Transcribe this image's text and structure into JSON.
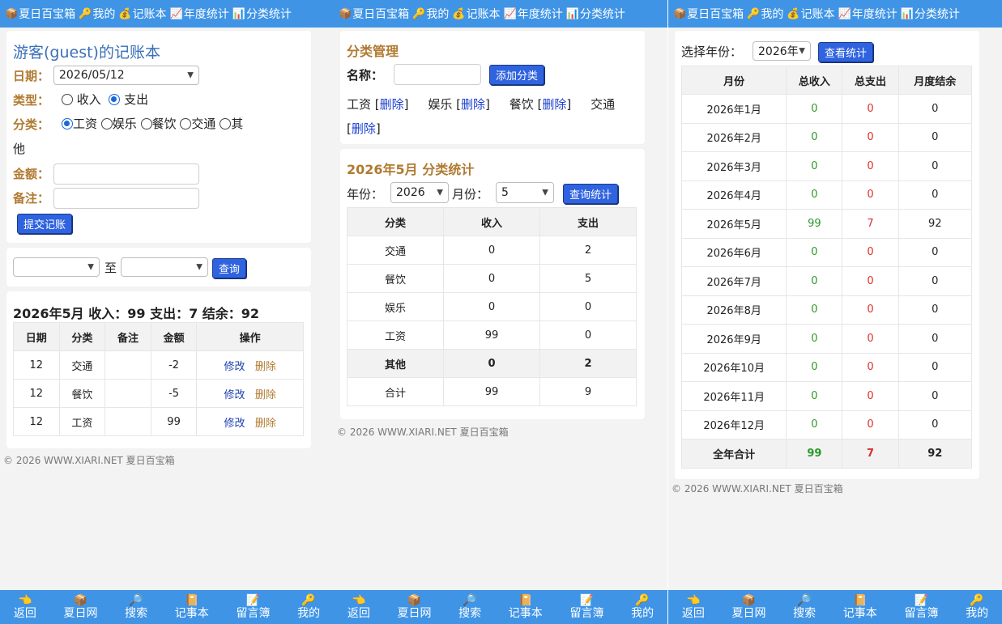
{
  "nav": [
    {
      "icon": "📦",
      "label": "夏日百宝箱"
    },
    {
      "icon": "🔑",
      "label": "我的"
    },
    {
      "icon": "💰",
      "label": "记账本"
    },
    {
      "icon": "📈",
      "label": "年度统计"
    },
    {
      "icon": "📊",
      "label": "分类统计"
    }
  ],
  "bottom": [
    {
      "icon": "👈",
      "label": "返回"
    },
    {
      "icon": "📦",
      "label": "夏日网"
    },
    {
      "icon": "🔎",
      "label": "搜索"
    },
    {
      "icon": "📔",
      "label": "记事本"
    },
    {
      "icon": "📝",
      "label": "留言簿"
    },
    {
      "icon": "🔑",
      "label": "我的"
    }
  ],
  "footer": "© 2026 WWW.XIARI.NET 夏日百宝箱",
  "ledger": {
    "title": "游客(guest)的记账本",
    "date_label": "日期：",
    "date_value": "2026/05/12",
    "type_label": "类型：",
    "type_income": "收入",
    "type_expense": "支出",
    "cat_label": "分类：",
    "cats": [
      "工资",
      "娱乐",
      "餐饮",
      "交通",
      "其"
    ],
    "cat_wrap": "他",
    "amount_label": "金额：",
    "note_label": "备注：",
    "submit": "提交记账",
    "range_to": "至",
    "query": "查询",
    "summary": "2026年5月 收入：99 支出：7 结余：92",
    "headers": [
      "日期",
      "分类",
      "备注",
      "金额",
      "操作"
    ],
    "rows": [
      {
        "day": "12",
        "cat": "交通",
        "note": "",
        "amt": "-2"
      },
      {
        "day": "12",
        "cat": "餐饮",
        "note": "",
        "amt": "-5"
      },
      {
        "day": "12",
        "cat": "工资",
        "note": "",
        "amt": "99"
      }
    ],
    "edit": "修改",
    "del": "删除"
  },
  "category": {
    "title": "分类管理",
    "name_label": "名称：",
    "add_btn": "添加分类",
    "items": [
      "工资",
      "娱乐",
      "餐饮",
      "交通"
    ],
    "del_word": "删除",
    "stats_title": "2026年5月 分类统计",
    "year_label": "年份：",
    "year_value": "2026",
    "month_label": "月份：",
    "month_value": "5",
    "query_btn": "查询统计",
    "headers": [
      "分类",
      "收入",
      "支出"
    ],
    "rows": [
      {
        "c": "交通",
        "i": "0",
        "e": "2"
      },
      {
        "c": "餐饮",
        "i": "0",
        "e": "5"
      },
      {
        "c": "娱乐",
        "i": "0",
        "e": "0"
      },
      {
        "c": "工资",
        "i": "99",
        "e": "0"
      },
      {
        "c": "其他",
        "i": "0",
        "e": "2"
      },
      {
        "c": "合计",
        "i": "99",
        "e": "9"
      }
    ]
  },
  "annual": {
    "year_label": "选择年份：",
    "year_value": "2026年",
    "view_btn": "查看统计",
    "headers": [
      "月份",
      "总收入",
      "总支出",
      "月度结余"
    ],
    "rows": [
      {
        "m": "2026年1月",
        "i": "0",
        "e": "0",
        "b": "0"
      },
      {
        "m": "2026年2月",
        "i": "0",
        "e": "0",
        "b": "0"
      },
      {
        "m": "2026年3月",
        "i": "0",
        "e": "0",
        "b": "0"
      },
      {
        "m": "2026年4月",
        "i": "0",
        "e": "0",
        "b": "0"
      },
      {
        "m": "2026年5月",
        "i": "99",
        "e": "7",
        "b": "92"
      },
      {
        "m": "2026年6月",
        "i": "0",
        "e": "0",
        "b": "0"
      },
      {
        "m": "2026年7月",
        "i": "0",
        "e": "0",
        "b": "0"
      },
      {
        "m": "2026年8月",
        "i": "0",
        "e": "0",
        "b": "0"
      },
      {
        "m": "2026年9月",
        "i": "0",
        "e": "0",
        "b": "0"
      },
      {
        "m": "2026年10月",
        "i": "0",
        "e": "0",
        "b": "0"
      },
      {
        "m": "2026年11月",
        "i": "0",
        "e": "0",
        "b": "0"
      },
      {
        "m": "2026年12月",
        "i": "0",
        "e": "0",
        "b": "0"
      }
    ],
    "total": {
      "m": "全年合计",
      "i": "99",
      "e": "7",
      "b": "92"
    }
  },
  "colors": {
    "nav_bg": "#3f94e6",
    "income": "#2a9a2a",
    "expense": "#d83030",
    "accent_label": "#b07a30",
    "button": "#2f63df"
  }
}
